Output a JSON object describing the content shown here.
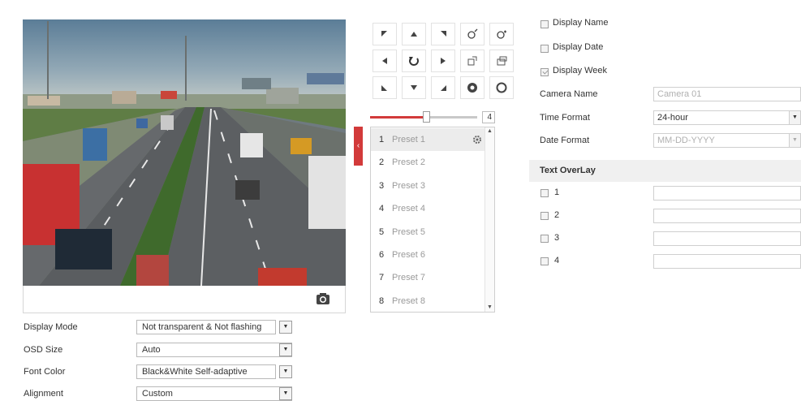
{
  "osd": {
    "display_name": {
      "label": "Display Name",
      "checked": false
    },
    "display_date": {
      "label": "Display Date",
      "checked": false
    },
    "display_week": {
      "label": "Display Week",
      "checked": true
    },
    "camera_name_label": "Camera Name",
    "camera_name_value": "Camera 01",
    "time_format_label": "Time Format",
    "time_format_value": "24-hour",
    "date_format_label": "Date Format",
    "date_format_value": "MM-DD-YYYY",
    "text_overlay_header": "Text OverLay",
    "overlays": [
      {
        "label": "1",
        "value": ""
      },
      {
        "label": "2",
        "value": ""
      },
      {
        "label": "3",
        "value": ""
      },
      {
        "label": "4",
        "value": ""
      }
    ]
  },
  "ptz": {
    "speed": 4,
    "speed_fraction": 0.52,
    "presets": [
      {
        "num": "1",
        "name": "Preset 1"
      },
      {
        "num": "2",
        "name": "Preset 2"
      },
      {
        "num": "3",
        "name": "Preset 3"
      },
      {
        "num": "4",
        "name": "Preset 4"
      },
      {
        "num": "5",
        "name": "Preset 5"
      },
      {
        "num": "6",
        "name": "Preset 6"
      },
      {
        "num": "7",
        "name": "Preset 7"
      },
      {
        "num": "8",
        "name": "Preset 8"
      }
    ],
    "selected_preset": 0,
    "icons": [
      [
        "arrow-up-left-icon",
        "arrow-up-icon",
        "arrow-up-right-icon",
        "zoom-in-icon",
        "zoom-out-icon"
      ],
      [
        "arrow-left-icon",
        "auto-pan-icon",
        "arrow-right-icon",
        "focus-near-icon",
        "focus-far-icon"
      ],
      [
        "arrow-down-left-icon",
        "arrow-down-icon",
        "arrow-down-right-icon",
        "iris-open-icon",
        "iris-close-icon"
      ]
    ]
  },
  "display": {
    "mode_label": "Display Mode",
    "mode_value": "Not transparent & Not flashing",
    "osd_size_label": "OSD Size",
    "osd_size_value": "Auto",
    "font_color_label": "Font Color",
    "font_color_value": "Black&White Self-adaptive",
    "alignment_label": "Alignment",
    "alignment_value": "Custom"
  },
  "colors": {
    "accent": "#d23a3a",
    "header_bg": "#f0f0f0",
    "muted_text": "#9a9a9a"
  }
}
